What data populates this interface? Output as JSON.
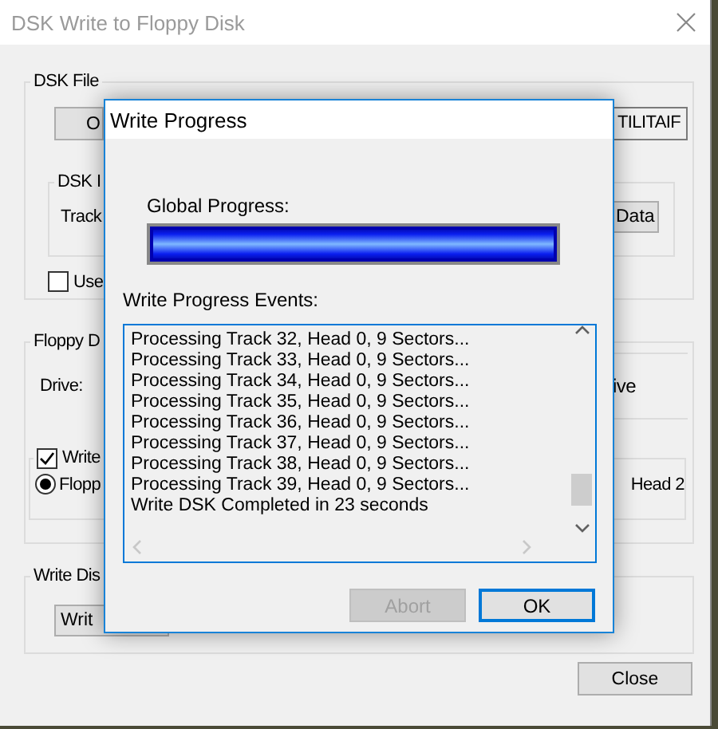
{
  "window": {
    "title": "DSK Write to Floppy Disk"
  },
  "dsk_file": {
    "label": "DSK File",
    "open_button": "O",
    "file_field": "TILITAIF",
    "dsk_info": {
      "label": "DSK I",
      "track_label": "Track",
      "data_button": "Data"
    },
    "use_checkbox": {
      "label": "Use",
      "checked": false
    }
  },
  "floppy": {
    "label": "Floppy D",
    "drive_label": "Drive:",
    "drive_box_text": "ive",
    "write_checkbox": {
      "label": "Write",
      "checked": true
    },
    "floppy_radio": {
      "label": "Flopp",
      "selected": true
    },
    "head_text": "Head 2"
  },
  "write_disk": {
    "label": "Write Dis",
    "write_button": "Writ"
  },
  "close_button": "Close",
  "dialog": {
    "title": "Write Progress",
    "progress_label": "Global Progress:",
    "progress": {
      "level": 1
    },
    "events_label": "Write Progress Events:",
    "events": [
      "Processing Track 32, Head 0, 9 Sectors...",
      "Processing Track 33, Head 0, 9 Sectors...",
      "Processing Track 34, Head 0, 9 Sectors...",
      "Processing Track 35, Head 0, 9 Sectors...",
      "Processing Track 36, Head 0, 9 Sectors...",
      "Processing Track 37, Head 0, 9 Sectors...",
      "Processing Track 38, Head 0, 9 Sectors...",
      "Processing Track 39, Head 0, 9 Sectors...",
      "Write DSK Completed in 23 seconds"
    ],
    "abort_button": {
      "label": "Abort",
      "disabled": true
    },
    "ok_button": {
      "label": "OK"
    }
  }
}
